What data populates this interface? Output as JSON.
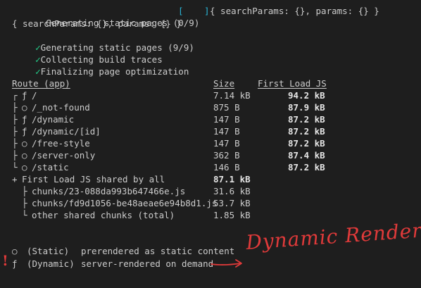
{
  "log": {
    "generating_progress": "Generating static pages (0/9)",
    "bracket_open": "[",
    "bracket_close": "]",
    "params_a": "{ searchParams: {}, params: {} }",
    "params_b": "{ searchParams: {}, params: {} }",
    "checkmark": "✓",
    "done_items": [
      "Generating static pages (9/9)",
      "Collecting build traces",
      "Finalizing page optimization"
    ]
  },
  "table": {
    "headers": {
      "route": "Route (app)",
      "size": "Size",
      "first_load": "First Load JS"
    },
    "rows": [
      {
        "prefix": "┌",
        "kind": "ƒ",
        "route": "/",
        "size": "7.14 kB",
        "first_load": "94.2 kB"
      },
      {
        "prefix": "├",
        "kind": "○",
        "route": "/_not-found",
        "size": "875 B",
        "first_load": "87.9 kB"
      },
      {
        "prefix": "├",
        "kind": "ƒ",
        "route": "/dynamic",
        "size": "147 B",
        "first_load": "87.2 kB"
      },
      {
        "prefix": "├",
        "kind": "ƒ",
        "route": "/dynamic/[id]",
        "size": "147 B",
        "first_load": "87.2 kB"
      },
      {
        "prefix": "├",
        "kind": "○",
        "route": "/free-style",
        "size": "147 B",
        "first_load": "87.2 kB"
      },
      {
        "prefix": "├",
        "kind": "○",
        "route": "/server-only",
        "size": "362 B",
        "first_load": "87.4 kB"
      },
      {
        "prefix": "└",
        "kind": "○",
        "route": "/static",
        "size": "146 B",
        "first_load": "87.2 kB"
      }
    ],
    "shared": {
      "prefix": "+",
      "label": "First Load JS shared by all",
      "size": "87.1 kB",
      "chunks": [
        {
          "prefix": "├",
          "name": "chunks/23-088da993b647466e.js",
          "size": "31.6 kB"
        },
        {
          "prefix": "├",
          "name": "chunks/fd9d1056-be48aeae6e94b8d1.js",
          "size": "53.7 kB"
        },
        {
          "prefix": "└",
          "name": "other shared chunks (total)",
          "size": "1.85 kB"
        }
      ]
    }
  },
  "legend": [
    {
      "symbol": "○",
      "type": "(Static)",
      "desc": "prerendered as static content"
    },
    {
      "symbol": "ƒ",
      "type": "(Dynamic)",
      "desc": "server-rendered on demand"
    }
  ],
  "annotation": {
    "text": "Dynamic Render",
    "mark": "!",
    "color": "#e03a3a"
  }
}
